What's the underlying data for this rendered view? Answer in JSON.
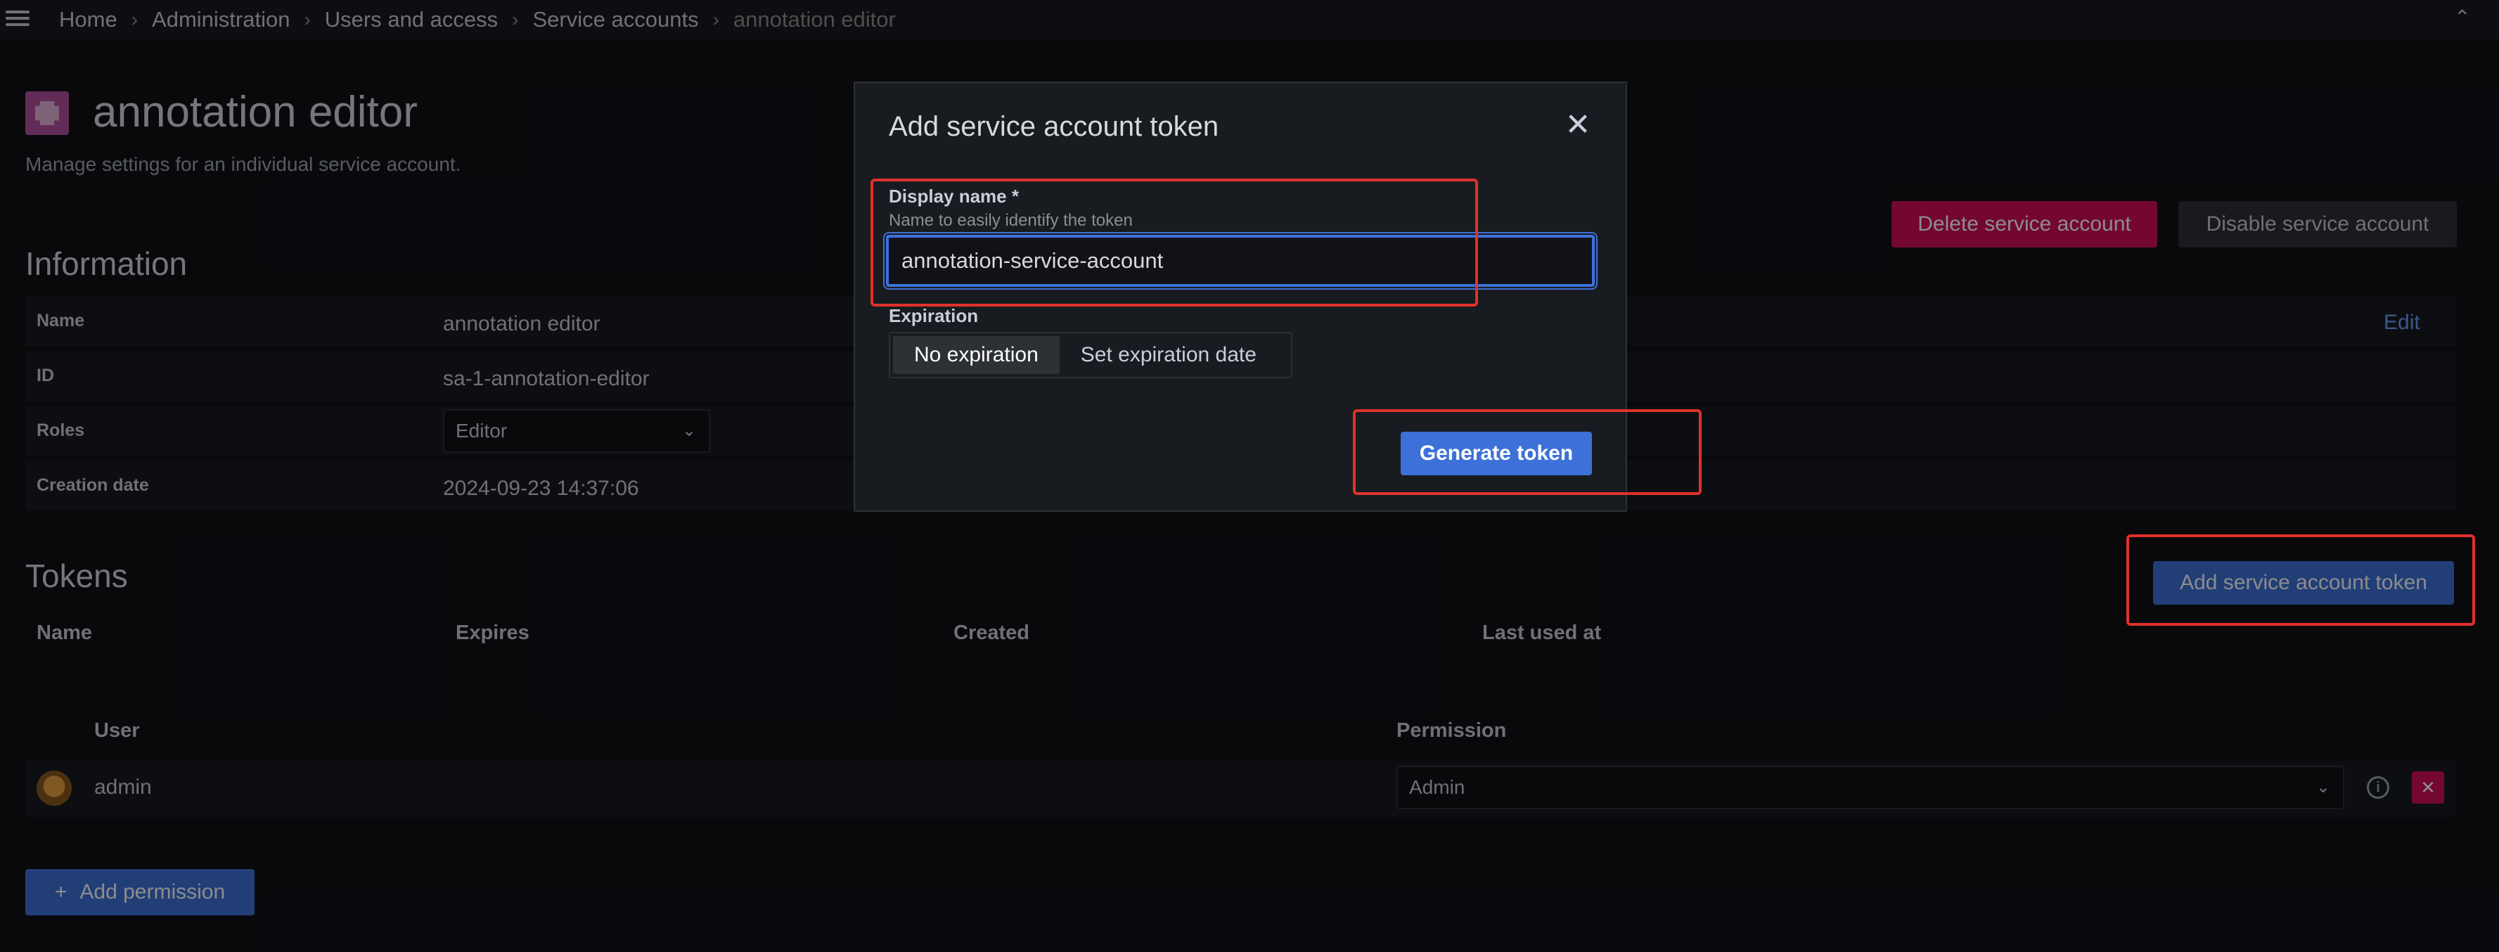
{
  "breadcrumb": {
    "items": [
      "Home",
      "Administration",
      "Users and access",
      "Service accounts"
    ],
    "current": "annotation editor",
    "separator": "›"
  },
  "page": {
    "title": "annotation editor",
    "subtitle": "Manage settings for an individual service account.",
    "delete_label": "Delete service account",
    "disable_label": "Disable service account"
  },
  "information": {
    "title": "Information",
    "edit_label": "Edit",
    "rows": [
      {
        "label": "Name",
        "value": "annotation editor"
      },
      {
        "label": "ID",
        "value": "sa-1-annotation-editor"
      },
      {
        "label": "Roles",
        "value": "Editor"
      },
      {
        "label": "Creation date",
        "value": "2024-09-23 14:37:06"
      }
    ]
  },
  "tokens": {
    "title": "Tokens",
    "add_label": "Add service account token",
    "columns": [
      "Name",
      "Expires",
      "Created",
      "Last used at"
    ]
  },
  "permissions": {
    "user_header": "User",
    "permission_header": "Permission",
    "rows": [
      {
        "user": "admin",
        "permission": "Admin"
      }
    ],
    "add_label": "Add permission",
    "add_prefix": "+"
  },
  "modal": {
    "title": "Add service account token",
    "close_glyph": "✕",
    "display_name_label": "Display name *",
    "display_name_desc": "Name to easily identify the token",
    "display_name_value": "annotation-service-account",
    "expiration_label": "Expiration",
    "expiration_options": [
      "No expiration",
      "Set expiration date"
    ],
    "expiration_selected": "No expiration",
    "generate_label": "Generate token"
  },
  "colors": {
    "background": "#111217",
    "panel": "#181b1f",
    "primary": "#3d71d9",
    "danger": "#d10e5c",
    "highlight": "#e0312b"
  }
}
